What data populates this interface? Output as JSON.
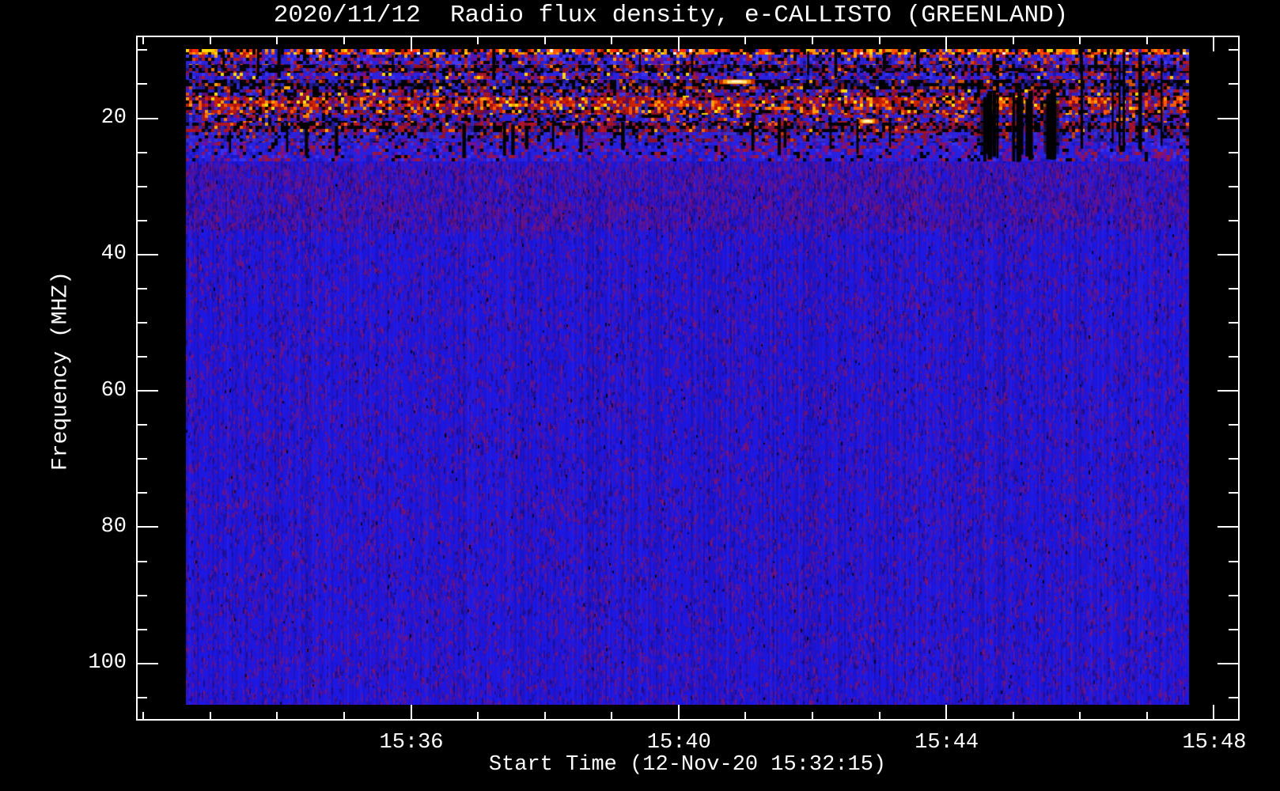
{
  "page": {
    "background": "#000000",
    "foreground": "#ffffff"
  },
  "chart_data": {
    "type": "heatmap",
    "title": "2020/11/12  Radio flux density, e-CALLISTO (GREENLAND)",
    "xlabel": "Start Time (12-Nov-20 15:32:15)",
    "ylabel": "Frequency (MHZ)",
    "x_axis": {
      "tick_labels": [
        "15:36",
        "15:40",
        "15:44",
        "15:48"
      ],
      "major_interval_min": 4,
      "minor_interval_min": 1,
      "start_label_time": "15:32:15"
    },
    "y_axis": {
      "tick_labels": [
        "20",
        "40",
        "60",
        "80",
        "100"
      ],
      "minor_interval_mhz": 5,
      "range_mhz": [
        8,
        108
      ],
      "inverted": true
    },
    "data_extent": {
      "freq_mhz": [
        10,
        106
      ],
      "time_start": "15:32:38",
      "time_end": "15:47:37"
    },
    "colormap": {
      "low": "#1d17e2",
      "mid": [
        "#6a10a0",
        "#8c1260",
        "#a01830"
      ],
      "high": [
        "#cc2200",
        "#ff5a00",
        "#ff9900",
        "#ffd800",
        "#ffffff"
      ],
      "gap": "#000000"
    },
    "body_texture": {
      "base": "#1d17e2",
      "speckles": [
        "#5a10a0",
        "#6f1588",
        "#3a0fb0",
        "#8c1260",
        "#200a70"
      ],
      "red_dots": "#8c1040"
    },
    "bands": [
      {
        "name": "rfi-hot-line",
        "f0": 10.0,
        "f1": 10.6,
        "palette": [
          [
            "#000000",
            24
          ],
          [
            "#ff5500",
            15
          ],
          [
            "#ff9900",
            12
          ],
          [
            "#ffd800",
            8
          ],
          [
            "#ff2a00",
            11
          ],
          [
            "#ffffff",
            3
          ],
          [
            "#bb1100",
            9
          ],
          [
            "#3322bb",
            9
          ],
          [
            "#2a22d8",
            9
          ]
        ]
      },
      {
        "name": "blue-red-mix",
        "f0": 10.6,
        "f1": 12.05,
        "palette": [
          [
            "#2a22d8",
            26
          ],
          [
            "#000000",
            14
          ],
          [
            "#b01828",
            15
          ],
          [
            "#6a10a0",
            11
          ],
          [
            "#e04800",
            6
          ],
          [
            "#4438f0",
            17
          ],
          [
            "#ff9900",
            3
          ],
          [
            "#1a1490",
            8
          ]
        ]
      },
      {
        "name": "dark-rows",
        "f0": 12.05,
        "f1": 13.25,
        "palette": [
          [
            "#000000",
            40
          ],
          [
            "#95101e",
            14
          ],
          [
            "#2a22c0",
            15
          ],
          [
            "#550a64",
            11
          ],
          [
            "#cc3300",
            5
          ],
          [
            "#1a1488",
            8
          ],
          [
            "#ff7700",
            2
          ],
          [
            "#3a30d8",
            5
          ]
        ]
      },
      {
        "name": "blue-speckle",
        "f0": 13.25,
        "f1": 14.35,
        "palette": [
          [
            "#2a22e0",
            34
          ],
          [
            "#1a16b0",
            13
          ],
          [
            "#a51830",
            14
          ],
          [
            "#000000",
            12
          ],
          [
            "#6a10a0",
            13
          ],
          [
            "#ff6a00",
            3
          ],
          [
            "#ffd800",
            2
          ],
          [
            "#3c34f0",
            9
          ]
        ]
      },
      {
        "name": "sparse-black",
        "f0": 14.35,
        "f1": 15.75,
        "palette": [
          [
            "#000000",
            44
          ],
          [
            "#221a9a",
            13
          ],
          [
            "#8c1018",
            12
          ],
          [
            "#d25400",
            6
          ],
          [
            "#2e26d0",
            13
          ],
          [
            "#ffaa00",
            2
          ],
          [
            "#6a10a0",
            4
          ],
          [
            "#1a1260",
            6
          ]
        ]
      },
      {
        "name": "dark-mixed",
        "f0": 15.75,
        "f1": 16.9,
        "palette": [
          [
            "#000000",
            28
          ],
          [
            "#2a22c8",
            20
          ],
          [
            "#a81424",
            16
          ],
          [
            "#5a0c70",
            10
          ],
          [
            "#e65000",
            7
          ],
          [
            "#3c34e8",
            10
          ],
          [
            "#ffd800",
            2
          ],
          [
            "#8c1040",
            7
          ]
        ]
      },
      {
        "name": "red-band",
        "f0": 16.9,
        "f1": 18.25,
        "palette": [
          [
            "#cc2200",
            20
          ],
          [
            "#ff5a00",
            14
          ],
          [
            "#a80e14",
            16
          ],
          [
            "#000000",
            12
          ],
          [
            "#ff9d00",
            7
          ],
          [
            "#2e26b0",
            11
          ],
          [
            "#660a50",
            8
          ],
          [
            "#ffe000",
            4
          ],
          [
            "#6a10a0",
            8
          ]
        ]
      },
      {
        "name": "red-blue-band",
        "f0": 18.25,
        "f1": 19.45,
        "palette": [
          [
            "#b81a10",
            16
          ],
          [
            "#ff5a00",
            8
          ],
          [
            "#8c0e20",
            15
          ],
          [
            "#000000",
            18
          ],
          [
            "#2e26b8",
            16
          ],
          [
            "#5a0c70",
            11
          ],
          [
            "#ff9d00",
            5
          ],
          [
            "#ffe000",
            2
          ],
          [
            "#3a30d8",
            9
          ]
        ]
      },
      {
        "name": "blue-black",
        "f0": 19.45,
        "f1": 20.55,
        "palette": [
          [
            "#2a22d8",
            27
          ],
          [
            "#000000",
            22
          ],
          [
            "#a51828",
            13
          ],
          [
            "#1a1690",
            13
          ],
          [
            "#6a10a0",
            13
          ],
          [
            "#ff7a00",
            4
          ],
          [
            "#3c34f0",
            8
          ]
        ]
      },
      {
        "name": "dark-red",
        "f0": 20.55,
        "f1": 22.0,
        "palette": [
          [
            "#000000",
            32
          ],
          [
            "#b01420",
            18
          ],
          [
            "#2e26b8",
            15
          ],
          [
            "#60104f",
            9
          ],
          [
            "#ff6000",
            5
          ],
          [
            "#221788",
            12
          ],
          [
            "#ffaa00",
            1
          ],
          [
            "#8c1040",
            8
          ]
        ]
      },
      {
        "name": "blue-transition",
        "f0": 22.0,
        "f1": 23.45,
        "palette": [
          [
            "#2a22dd",
            32
          ],
          [
            "#000000",
            13
          ],
          [
            "#8c1230",
            12
          ],
          [
            "#3a2fd0",
            16
          ],
          [
            "#5a10a0",
            14
          ],
          [
            "#d04000",
            3
          ],
          [
            "#1c1690",
            10
          ]
        ]
      },
      {
        "name": "upper-body",
        "f0": 23.45,
        "f1": 26.3,
        "palette": [
          [
            "#2620e0",
            40
          ],
          [
            "#1c16c0",
            15
          ],
          [
            "#6a10a0",
            15
          ],
          [
            "#8c1260",
            10
          ],
          [
            "#000000",
            7
          ],
          [
            "#3a30f0",
            8
          ],
          [
            "#a01830",
            5
          ]
        ]
      }
    ],
    "events": [
      {
        "type": "bright_burst",
        "time": "15:40:52",
        "freq_mhz": 14.5,
        "width_s": 25,
        "colors": [
          "#cc2800",
          "#ff9900",
          "#ffe87a",
          "#fffbe0"
        ]
      },
      {
        "type": "bright_burst",
        "time": "15:42:49",
        "freq_mhz": 20.3,
        "width_s": 13,
        "colors": [
          "#cc2800",
          "#ff9900",
          "#ffe87a",
          "#fffbe0"
        ]
      },
      {
        "type": "red_dash",
        "time": "15:43:30",
        "freq_mhz": 21.9,
        "width_s": 45,
        "color": "#b01422"
      },
      {
        "type": "red_dash",
        "time": "15:44:40",
        "freq_mhz": 22.3,
        "width_s": 30,
        "color": "#a01020"
      },
      {
        "type": "dropout_cluster",
        "time_start": "15:44:29",
        "time_end": "15:45:37",
        "freq_mhz": [
          16.5,
          26.5
        ],
        "count": 16
      },
      {
        "type": "dropout_scatter",
        "time_start": "15:36:30",
        "time_end": "15:39:40",
        "freq_mhz": [
          20.5,
          25.8
        ],
        "count": 9
      },
      {
        "type": "dropout_scatter",
        "time_start": "15:40:40",
        "time_end": "15:43:10",
        "freq_mhz": [
          19.5,
          25.5
        ],
        "count": 6
      },
      {
        "type": "dropout_scatter",
        "time_start": "15:45:50",
        "time_end": "15:47:20",
        "freq_mhz": [
          11.0,
          25.0
        ],
        "count": 7
      },
      {
        "type": "dropout_scatter",
        "time_start": "15:33:00",
        "time_end": "15:35:30",
        "freq_mhz": [
          21.0,
          25.5
        ],
        "count": 4
      },
      {
        "type": "dropout_scatter",
        "time_start": "15:33:00",
        "time_end": "15:47:20",
        "freq_mhz": [
          10.0,
          14.0
        ],
        "count": 14
      }
    ]
  }
}
